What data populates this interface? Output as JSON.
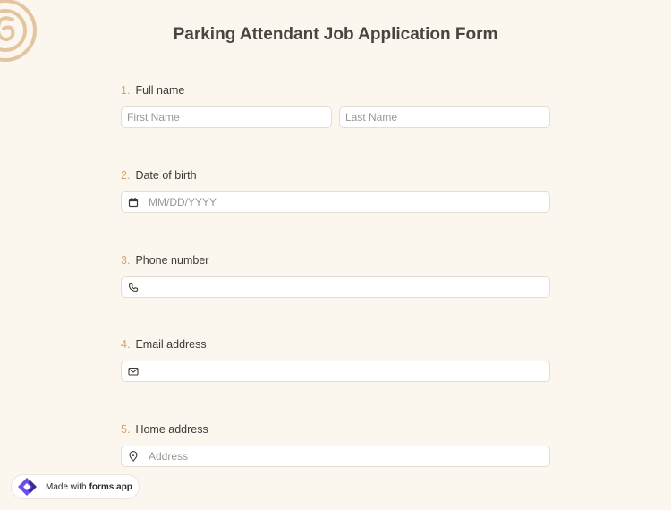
{
  "form": {
    "title": "Parking Attendant Job Application Form",
    "accent_color": "#d9a366",
    "questions": [
      {
        "number": "1.",
        "label": "Full name",
        "fields": [
          {
            "placeholder": "First Name"
          },
          {
            "placeholder": "Last Name"
          }
        ]
      },
      {
        "number": "2.",
        "label": "Date of birth",
        "icon": "calendar-icon",
        "placeholder": "MM/DD/YYYY"
      },
      {
        "number": "3.",
        "label": "Phone number",
        "icon": "phone-icon",
        "placeholder": ""
      },
      {
        "number": "4.",
        "label": "Email address",
        "icon": "mail-icon",
        "placeholder": ""
      },
      {
        "number": "5.",
        "label": "Home address",
        "icon": "location-pin-icon",
        "placeholder": "Address"
      }
    ]
  },
  "badge": {
    "prefix": "Made with",
    "brand": "forms.app",
    "icon": "forms-app-logo-icon"
  }
}
